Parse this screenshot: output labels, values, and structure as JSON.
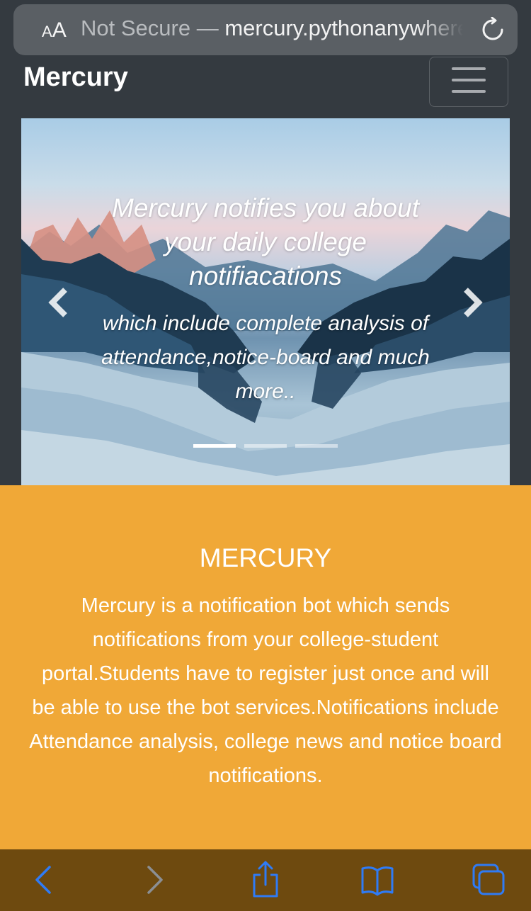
{
  "browser": {
    "aa_label_small": "A",
    "aa_label_large": "A",
    "security_label": "Not Secure",
    "separator": " — ",
    "url": "mercury.pythonanywhere.com"
  },
  "navbar": {
    "brand": "Mercury"
  },
  "carousel": {
    "caption_title": "Mercury notifies you about your daily college notifiacations",
    "caption_text": "which include complete analysis of attendance,notice-board and much more..",
    "slide_count": 3,
    "active_slide": 1
  },
  "about": {
    "heading": "MERCURY",
    "body": "Mercury is a notification bot which sends notifications from your college-student portal.Students have to register just once and will be able to use the bot services.Notifications include Attendance analysis, college news and notice board notifications."
  },
  "colors": {
    "navbar_bg": "#343a40",
    "about_bg": "#f0a837",
    "toolbar_bg": "#6e4a0f",
    "toolbar_icon": "#2f7bf5"
  },
  "toolbar_icons": [
    "back-icon",
    "forward-icon",
    "share-icon",
    "bookmarks-icon",
    "tabs-icon"
  ]
}
